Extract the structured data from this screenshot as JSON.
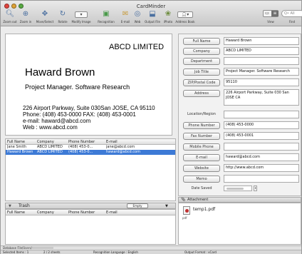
{
  "window": {
    "title": "CardMinder"
  },
  "toolbar": {
    "zoom_out": "Zoom out",
    "zoom_in": "Zoom in",
    "move_select": "Move/Select",
    "rotate": "Rotate",
    "modify_image": "Modify Image",
    "recognition": "Recognition",
    "email": "E-mail",
    "web": "Web",
    "output_file": "Output File",
    "photo": "iPhoto",
    "address_book": "Address Book",
    "view": "View",
    "find": "Find",
    "search_placeholder": "Q• All"
  },
  "card": {
    "company": "ABCD LIMITED",
    "name": "Haward Brown",
    "title": "Project Manager. Software Research",
    "address": "226 Airport Parkway, Suite 030San JOSE, CA 95110",
    "phone_fax": "Phone: (408) 453-0000      FAX: (408) 453-0001",
    "email": "e-mail: haward@abcd.com",
    "web": "Web   : www.abcd.com"
  },
  "list": {
    "headers": [
      "Full Name",
      "Company",
      "Phone Number",
      "E-mail"
    ],
    "rows": [
      [
        "Jane Smith",
        "ABCD LIMITED",
        "(408) 453-0...",
        "jane@abcd.com"
      ],
      [
        "Haward Brown",
        "ABCD LIMITED",
        "(408) 453-0...",
        "haward@abcd.com"
      ]
    ]
  },
  "trash": {
    "label": "Trash",
    "empty_button": "Empty",
    "headers": [
      "Full Name",
      "Company",
      "Phone Number",
      "E-mail"
    ]
  },
  "form": {
    "full_name_label": "Full Name",
    "full_name": "Haward Brown",
    "company_label": "Company",
    "company": "ABCD LIMITED",
    "department_label": "Department",
    "department": "",
    "job_title_label": "Job Title",
    "job_title": "Project Manager. Software Research",
    "zip_label": "ZIP/Postal Code",
    "zip": "95110",
    "address_label": "Address",
    "address": "226 Airport Parkway, Suite 030 San JOSE CA",
    "location_label": "Location/Region",
    "location": "",
    "phone_label": "Phone Number",
    "phone": "(408) 453-0000",
    "fax_label": "Fax Number",
    "fax": "(408) 453-0001",
    "mobile_label": "Mobile Phone",
    "mobile": "",
    "email_label": "E-mail",
    "email": "haward@abcd.com",
    "website_label": "Website",
    "website": "http://www.abcd.com",
    "memo_label": "Memo",
    "memo": "",
    "date_saved_label": "Date Saved"
  },
  "attachment": {
    "label": "Attachment",
    "file": "temp1.pdf",
    "file_type": "pdf"
  },
  "db": {
    "label": "Database File",
    "path": "/Users/"
  },
  "status": {
    "selected": "Selected Items : 1",
    "sheets": "2 / 2 sheets",
    "recognition": "Recognition Language : English",
    "output": "Output Format : vCard"
  }
}
